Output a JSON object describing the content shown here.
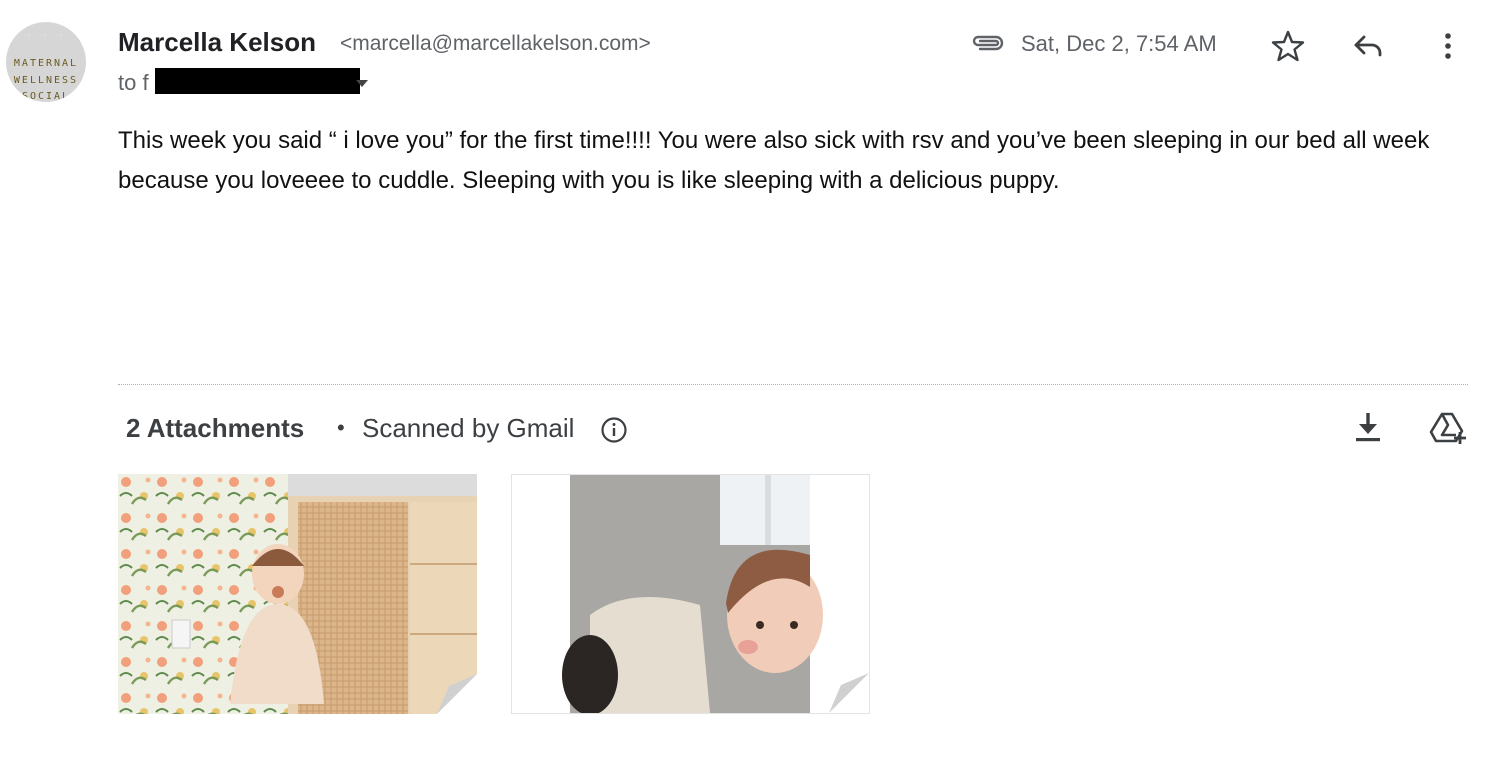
{
  "sender": {
    "avatar_text": [
      "MATERNAL",
      "WELLNESS",
      "SOCIAL"
    ],
    "name": "Marcella Kelson",
    "email": "<marcella@marcellakelson.com>"
  },
  "recipient": {
    "prefix": "to f"
  },
  "meta": {
    "date": "Sat, Dec 2, 7:54 AM",
    "icons": [
      "attachment-icon",
      "star-icon",
      "reply-icon",
      "more-vert-icon"
    ]
  },
  "message": {
    "body": "This week you said “ i love you” for the first time!!!! You were also sick with rsv and you’ve been sleeping in our bed all week because you loveeee to cuddle. Sleeping with you is like sleeping with a delicious puppy."
  },
  "attachments": {
    "count_label": "2 Attachments",
    "separator": "•",
    "scanned_label": "Scanned by Gmail",
    "icons": [
      "info-icon",
      "download-icon",
      "add-to-drive-icon"
    ],
    "items": [
      {
        "kind": "image",
        "alt": "toddler sitting against floral wallpaper"
      },
      {
        "kind": "image",
        "alt": "toddler lying in bed"
      }
    ]
  },
  "colors": {
    "text": "#202124",
    "muted": "#5f6368",
    "divider": "#b0b0b0"
  }
}
